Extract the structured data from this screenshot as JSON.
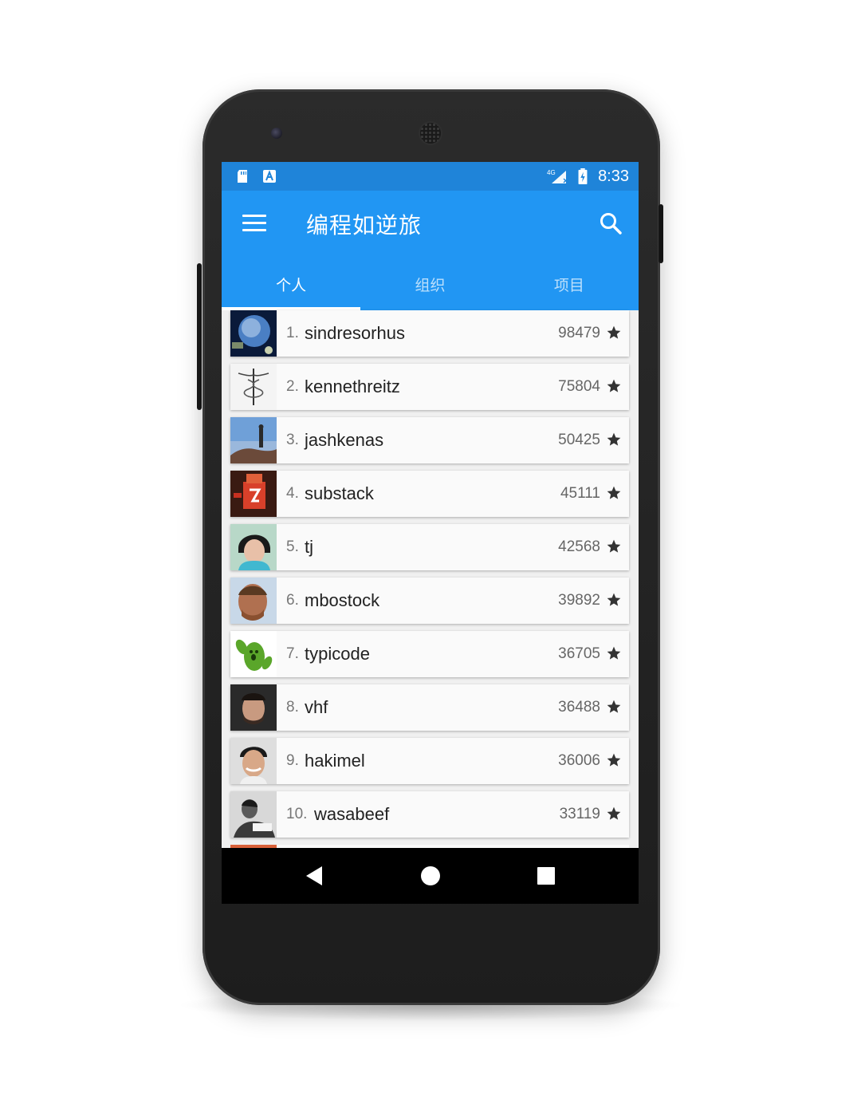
{
  "status_bar": {
    "time": "8:33",
    "network": "4G"
  },
  "app_bar": {
    "title": "编程如逆旅",
    "menu_icon": "menu-icon",
    "search_icon": "search-icon"
  },
  "tabs": [
    {
      "label": "个人",
      "selected": true
    },
    {
      "label": "组织",
      "selected": false
    },
    {
      "label": "项目",
      "selected": false
    }
  ],
  "users": [
    {
      "rank": "1.",
      "name": "sindresorhus",
      "stars": "98479"
    },
    {
      "rank": "2.",
      "name": "kennethreitz",
      "stars": "75804"
    },
    {
      "rank": "3.",
      "name": "jashkenas",
      "stars": "50425"
    },
    {
      "rank": "4.",
      "name": "substack",
      "stars": "45111"
    },
    {
      "rank": "5.",
      "name": "tj",
      "stars": "42568"
    },
    {
      "rank": "6.",
      "name": "mbostock",
      "stars": "39892"
    },
    {
      "rank": "7.",
      "name": "typicode",
      "stars": "36705"
    },
    {
      "rank": "8.",
      "name": "vhf",
      "stars": "36488"
    },
    {
      "rank": "9.",
      "name": "hakimel",
      "stars": "36006"
    },
    {
      "rank": "10.",
      "name": "wasabeef",
      "stars": "33119"
    }
  ],
  "nav_bar": {
    "back": "back-icon",
    "home": "home-icon",
    "recents": "recents-icon"
  },
  "colors": {
    "primary": "#2196f3",
    "status_bar": "#1f84d9"
  }
}
